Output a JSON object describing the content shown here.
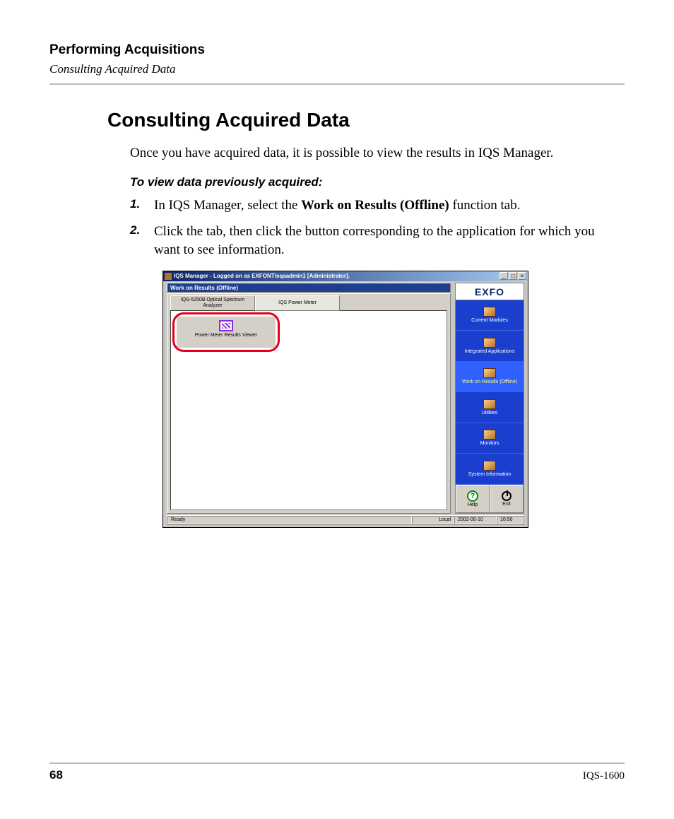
{
  "header": {
    "title": "Performing Acquisitions",
    "subtitle": "Consulting Acquired Data"
  },
  "section_title": "Consulting Acquired Data",
  "intro": "Once you have acquired data, it is possible to view the results in IQS Manager.",
  "subhead": "To view data previously acquired:",
  "steps": [
    {
      "num": "1.",
      "pre": "In IQS Manager, select the ",
      "bold": "Work on Results (Offline)",
      "post": " function tab."
    },
    {
      "num": "2.",
      "pre": "Click the tab, then click the button corresponding to the application for which you want to see information.",
      "bold": "",
      "post": ""
    }
  ],
  "screenshot": {
    "titlebar": "IQS Manager - Logged on as EXFONT\\sqaadmin1 [Administrator].",
    "win_min": "_",
    "win_max": "□",
    "win_close": "×",
    "blue_header": "Work on Results (Offline)",
    "tabs": [
      "IQS-5250B Optical Spectrum Analyzer",
      "IQS Power Meter"
    ],
    "app_button": "Power Meter Results Viewer",
    "logo": "EXFO",
    "nav": [
      {
        "label": "Current Modules",
        "selected": false
      },
      {
        "label": "Integrated Applications",
        "selected": false
      },
      {
        "label": "Work on Results (Offline)",
        "selected": true
      },
      {
        "label": "Utilities",
        "selected": false
      },
      {
        "label": "Monitors",
        "selected": false
      },
      {
        "label": "System Information",
        "selected": false
      }
    ],
    "help_label": "Help",
    "exit_label": "Exit",
    "status": {
      "ready": "Ready",
      "mode": "Local",
      "date": "2002-06-10",
      "time": "10:50"
    }
  },
  "footer": {
    "page": "68",
    "doc": "IQS-1600"
  }
}
